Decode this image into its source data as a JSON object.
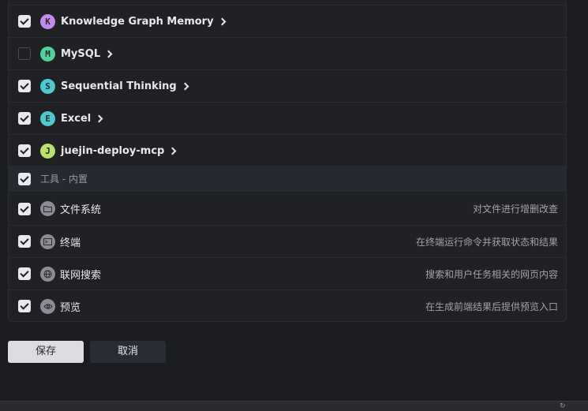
{
  "mcp_servers": [
    {
      "initial": "K",
      "name": "Knowledge Graph Memory",
      "checked": true,
      "color": "#c58af0"
    },
    {
      "initial": "M",
      "name": "MySQL",
      "checked": false,
      "color": "#4fd39a"
    },
    {
      "initial": "S",
      "name": "Sequential Thinking",
      "checked": true,
      "color": "#4dc9d1"
    },
    {
      "initial": "E",
      "name": "Excel",
      "checked": true,
      "color": "#4dc9d1"
    },
    {
      "initial": "J",
      "name": "juejin-deploy-mcp",
      "checked": true,
      "color": "#b9e26a"
    }
  ],
  "tools_group": {
    "label": "工具 - 内置",
    "checked": true
  },
  "tools": [
    {
      "name": "文件系统",
      "desc": "对文件进行增删改查",
      "icon": "folder-icon",
      "checked": true
    },
    {
      "name": "终端",
      "desc": "在终端运行命令并获取状态和结果",
      "icon": "terminal-icon",
      "checked": true
    },
    {
      "name": "联网搜索",
      "desc": "搜索和用户任务相关的网页内容",
      "icon": "globe-icon",
      "checked": true
    },
    {
      "name": "预览",
      "desc": "在生成前端结果后提供预览入口",
      "icon": "eye-icon",
      "checked": true
    }
  ],
  "buttons": {
    "save": "保存",
    "cancel": "取消"
  }
}
